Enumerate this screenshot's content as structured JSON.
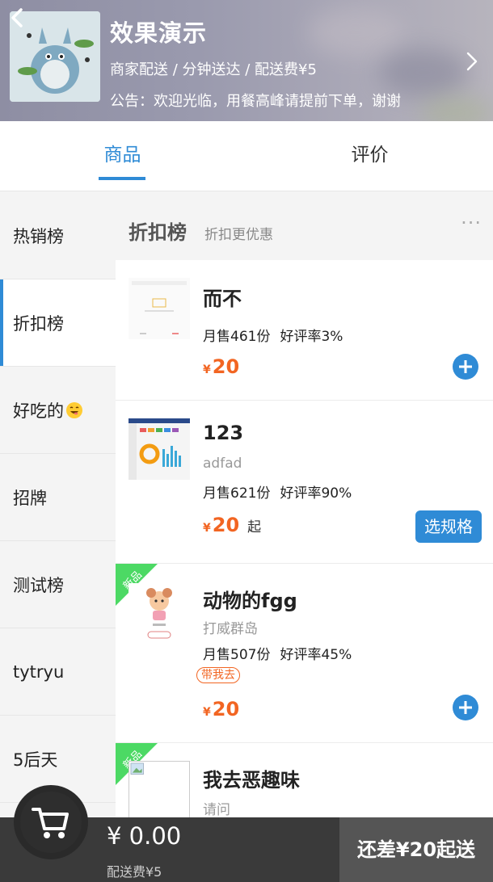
{
  "seller": {
    "name": "效果演示",
    "info": "商家配送 / 分钟送达 / 配送费¥5",
    "notice": "公告：欢迎光临，用餐高峰请提前下单，谢谢"
  },
  "tabs": [
    {
      "label": "商品"
    },
    {
      "label": "评价"
    }
  ],
  "sidebar": {
    "items": [
      {
        "label": "热销榜"
      },
      {
        "label": "折扣榜"
      },
      {
        "label": "好吃的"
      },
      {
        "label": "招牌"
      },
      {
        "label": "测试榜"
      },
      {
        "label": "tytryu"
      },
      {
        "label": "5后天"
      }
    ],
    "active_index": 1
  },
  "category": {
    "title": "折扣榜",
    "subtitle": "折扣更优惠",
    "more": "···"
  },
  "foods": [
    {
      "name": "而不",
      "desc": "",
      "sales": "月售461份",
      "rating": "好评率3%",
      "currency": "¥",
      "price": "20",
      "price_suffix": "",
      "action": "add"
    },
    {
      "name": "123",
      "desc": "adfad",
      "sales": "月售621份",
      "rating": "好评率90%",
      "currency": "¥",
      "price": "20",
      "price_suffix": "起",
      "action": "spec",
      "action_label": "选规格"
    },
    {
      "name": "动物的fgg",
      "desc": "打威群岛",
      "sales": "月售507份",
      "rating": "好评率45%",
      "tag": "带我去",
      "badge": "新品",
      "currency": "¥",
      "price": "20",
      "price_suffix": "",
      "action": "add"
    },
    {
      "name": "我去恶趣味",
      "desc": "请问",
      "badge": "新品"
    }
  ],
  "cart": {
    "total": "¥ 0.00",
    "fee": "配送费¥5",
    "submit": "还差¥20起送"
  },
  "colors": {
    "accent": "#2f8bd6",
    "price": "#f26522",
    "new_badge": "#4cd964",
    "cartbar": "#3a3a3a"
  },
  "icons": [
    "back-arrow-icon",
    "chevron-right-icon",
    "plus-icon",
    "cart-icon",
    "smile-emoji-icon"
  ]
}
